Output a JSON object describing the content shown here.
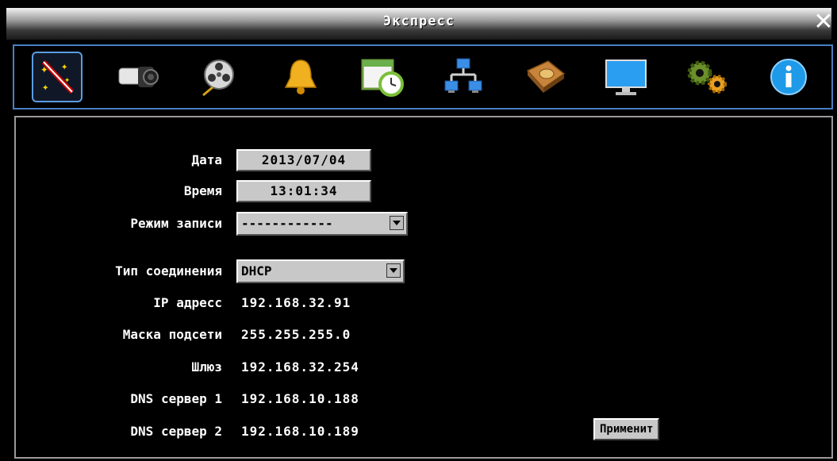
{
  "window": {
    "title": "Экспресс",
    "close_glyph": "✕"
  },
  "toolbar": {
    "items": [
      {
        "name": "wizard-icon",
        "active": true
      },
      {
        "name": "camera-icon"
      },
      {
        "name": "film-reel-icon"
      },
      {
        "name": "bell-icon"
      },
      {
        "name": "schedule-clock-icon"
      },
      {
        "name": "network-icon"
      },
      {
        "name": "hard-disk-icon"
      },
      {
        "name": "monitor-icon"
      },
      {
        "name": "gears-icon"
      },
      {
        "name": "info-icon"
      }
    ]
  },
  "form": {
    "date_label": "Дата",
    "date_value": "2013/07/04",
    "time_label": "Время",
    "time_value": "13:01:34",
    "record_mode_label": "Режим записи",
    "record_mode_value": "------------",
    "connection_type_label": "Тип соединения",
    "connection_type_value": "DHCP",
    "ip_label": "IP адресс",
    "ip_value": "192.168.32.91",
    "mask_label": "Маска подсети",
    "mask_value": "255.255.255.0",
    "gateway_label": "Шлюз",
    "gateway_value": "192.168.32.254",
    "dns1_label": "DNS сервер 1",
    "dns1_value": "192.168.10.188",
    "dns2_label": "DNS сервер 2",
    "dns2_value": "192.168.10.189",
    "apply_label": "Применит"
  }
}
